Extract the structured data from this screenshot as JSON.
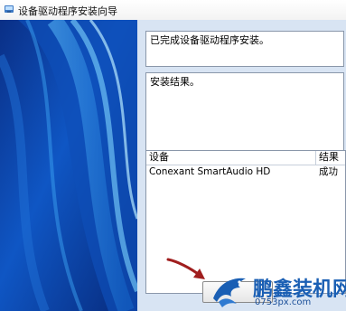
{
  "window": {
    "title": "设备驱动程序安装向导"
  },
  "content": {
    "status_text": "已完成设备驱动程序安装。",
    "result_label": "安装结果。",
    "table": {
      "columns": [
        "设备",
        "结果"
      ],
      "rows": [
        {
          "device": "Conexant SmartAudio HD",
          "result": "成功"
        }
      ]
    },
    "finish_button_label": ""
  },
  "watermark": {
    "brand": "鹏鑫装机网",
    "url": "0753px.com"
  },
  "colors": {
    "window_bg": "#d8e4f3",
    "panel_blue": "#0b3f9e",
    "watermark_blue": "#1a5fb4",
    "arrow_red": "#a01e1e"
  },
  "icons": {
    "title": "installer-icon",
    "annotation": "red-arrow-icon",
    "watermark_logo": "dragon-logo-icon"
  }
}
